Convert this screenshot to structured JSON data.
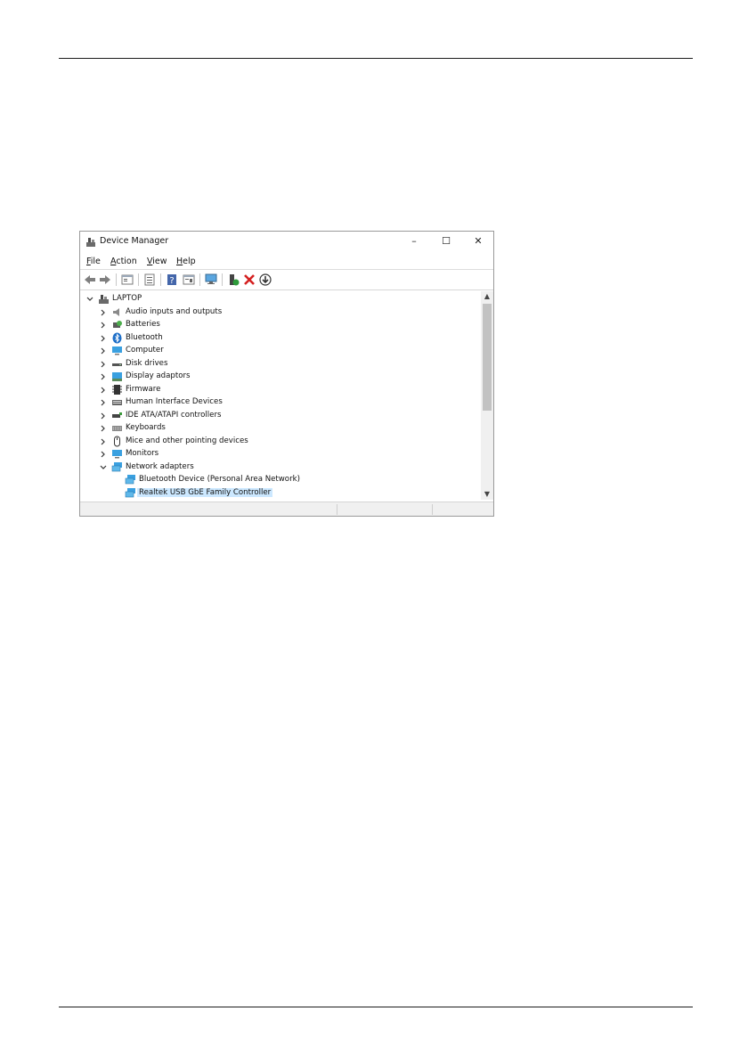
{
  "window": {
    "title": "Device Manager",
    "controls": {
      "minimize": "–",
      "maximize": "☐",
      "close": "✕"
    }
  },
  "menu": {
    "file": {
      "accel": "F",
      "rest": "ile"
    },
    "action": {
      "accel": "A",
      "rest": "ction"
    },
    "view": {
      "accel": "V",
      "rest": "iew"
    },
    "help": {
      "accel": "H",
      "rest": "elp"
    }
  },
  "toolbar": {
    "icons": [
      "back-icon",
      "forward-icon",
      "show-hide-console-tree-icon",
      "properties-icon",
      "help-icon",
      "view-icon",
      "scan-hardware-icon",
      "update-driver-icon",
      "uninstall-icon",
      "download-icon"
    ]
  },
  "tree": {
    "root": "LAPTOP",
    "categories": [
      "Audio inputs and outputs",
      "Batteries",
      "Bluetooth",
      "Computer",
      "Disk drives",
      "Display adaptors",
      "Firmware",
      "Human Interface Devices",
      "IDE ATA/ATAPI controllers",
      "Keyboards",
      "Mice and other pointing devices",
      "Monitors",
      "Network adapters"
    ],
    "network_children": [
      "Bluetooth Device (Personal Area Network)",
      "Realtek USB GbE Family Controller"
    ],
    "selected": "Realtek USB GbE Family Controller"
  },
  "colors": {
    "selection": "#cce8ff",
    "monitor_blue": "#3aa0e0",
    "uninstall_red": "#d42020"
  }
}
